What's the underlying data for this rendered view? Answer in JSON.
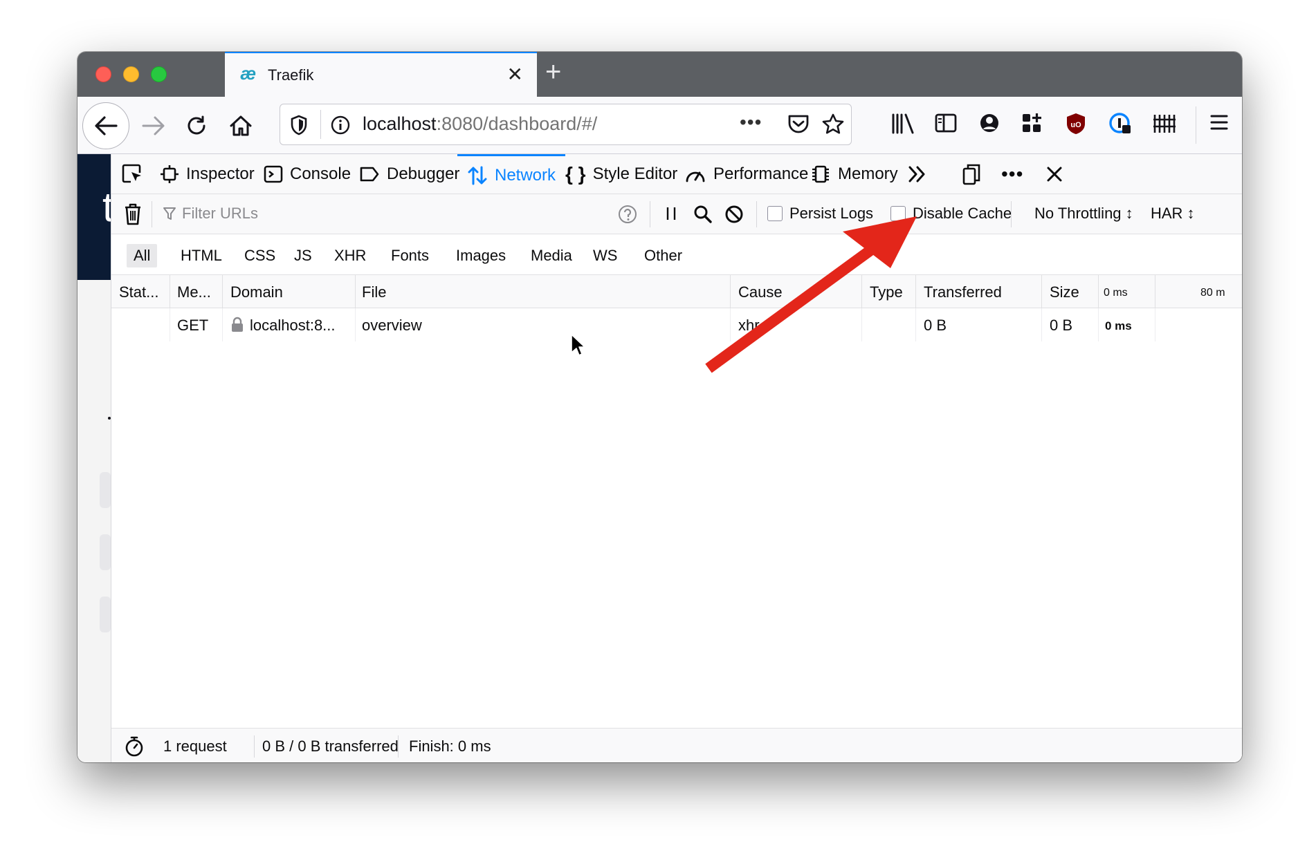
{
  "browser": {
    "tab_title": "Traefik",
    "tab_icon": "traefik-ae-logo",
    "url_host": "localhost",
    "url_rest": ":8080/dashboard/#/",
    "url_more": "•••"
  },
  "devtools": {
    "tabs": [
      {
        "label": "Inspector",
        "icon": "inspector-icon"
      },
      {
        "label": "Console",
        "icon": "console-icon"
      },
      {
        "label": "Debugger",
        "icon": "debugger-icon"
      },
      {
        "label": "Network",
        "icon": "network-icon",
        "active": true
      },
      {
        "label": "Style Editor",
        "icon": "style-editor-icon"
      },
      {
        "label": "Performance",
        "icon": "performance-icon"
      },
      {
        "label": "Memory",
        "icon": "memory-icon"
      }
    ],
    "toolbar": {
      "filter_placeholder": "Filter URLs",
      "persist_logs": "Persist Logs",
      "persist_logs_checked": false,
      "disable_cache": "Disable Cache",
      "disable_cache_checked": false,
      "throttling": "No Throttling ↕",
      "har": "HAR ↕"
    },
    "type_filters": [
      "All",
      "HTML",
      "CSS",
      "JS",
      "XHR",
      "Fonts",
      "Images",
      "Media",
      "WS",
      "Other"
    ],
    "type_filter_active": "All",
    "columns": [
      "Stat...",
      "Me...",
      "Domain",
      "File",
      "Cause",
      "Type",
      "Transferred",
      "Size",
      "0 ms",
      "80 m"
    ],
    "requests": [
      {
        "status": "",
        "method": "GET",
        "domain": "localhost:8...",
        "file": "overview",
        "cause": "xhr",
        "type": "",
        "transferred": "0 B",
        "size": "0 B",
        "timing": "0 ms"
      }
    ],
    "status": {
      "requests": "1 request",
      "transferred": "0 B / 0 B transferred",
      "finish": "Finish: 0 ms"
    }
  },
  "page_letter": "t",
  "colors": {
    "accent": "#0a84ff",
    "annotation_arrow": "#e3261a",
    "tab_strip": "#5c5f63",
    "page_header": "#0b1b34"
  }
}
